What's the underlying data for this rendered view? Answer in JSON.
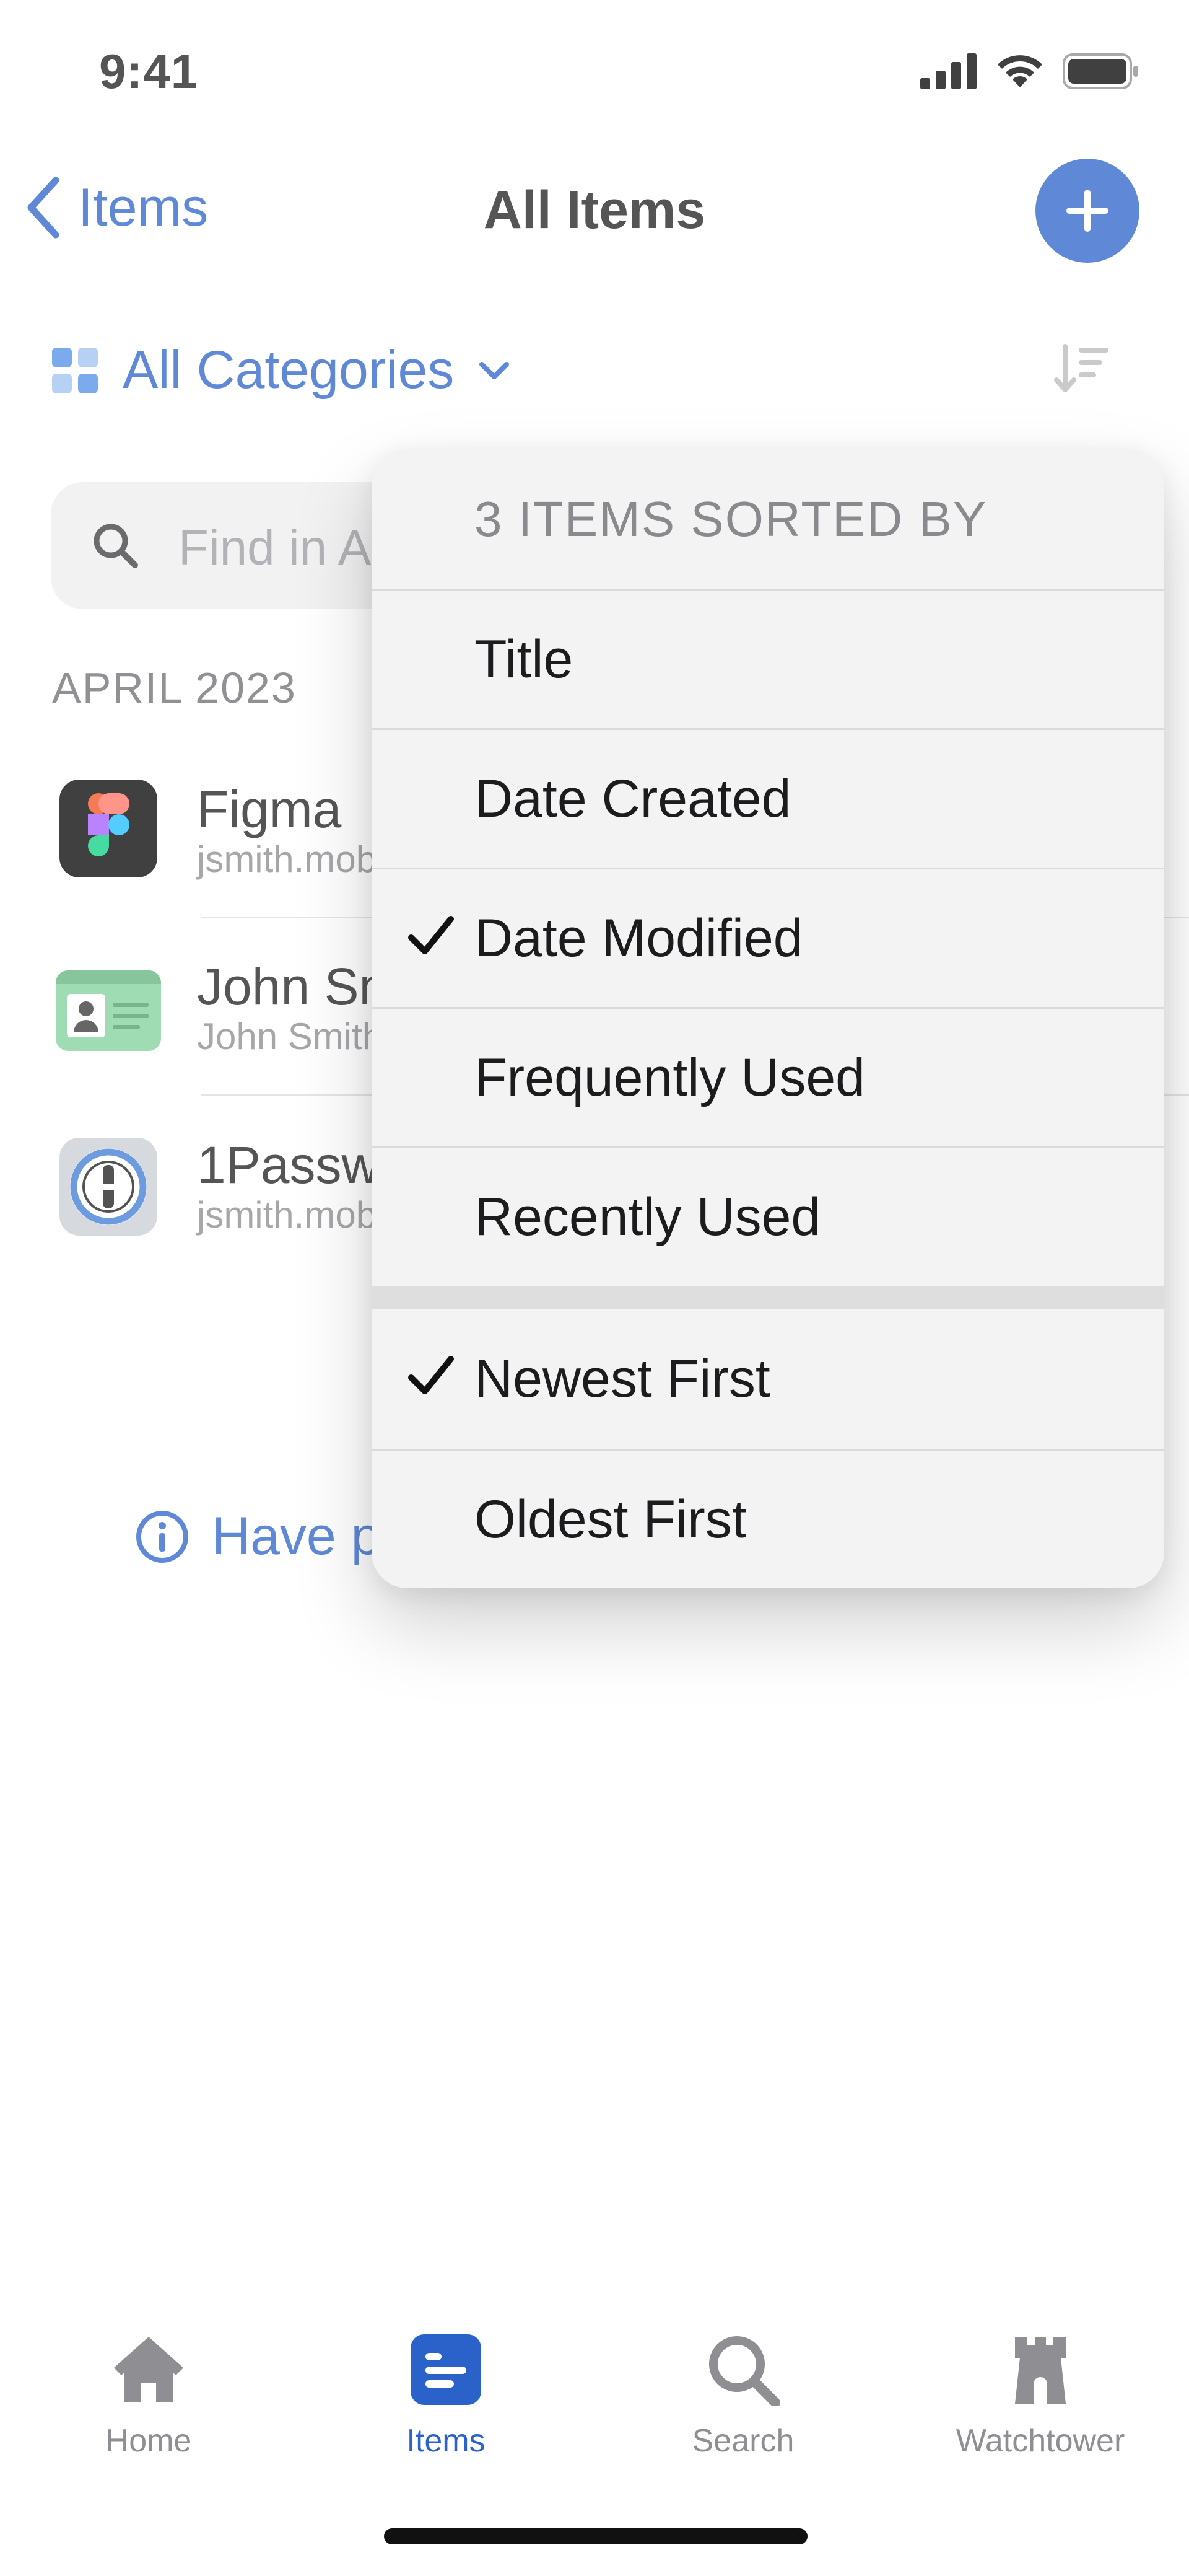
{
  "status_bar": {
    "time": "9:41"
  },
  "nav": {
    "back_label": "Items",
    "title": "All Items"
  },
  "filter": {
    "category_label": "All Categories"
  },
  "search": {
    "placeholder": "Find in All Items"
  },
  "list": {
    "section_header": "APRIL 2023",
    "items": [
      {
        "title": "Figma",
        "subtitle": "jsmith.mobile@example.com",
        "icon": "figma-icon"
      },
      {
        "title": "John Smith",
        "subtitle": "John Smith",
        "icon": "identity-card-icon"
      },
      {
        "title": "1Password Account",
        "subtitle": "jsmith.mobile@example.com",
        "icon": "onepassword-icon"
      }
    ],
    "info_link": "Have products to import?"
  },
  "sort_menu": {
    "header": "3 ITEMS SORTED BY",
    "sort_fields": [
      {
        "label": "Title",
        "checked": false
      },
      {
        "label": "Date Created",
        "checked": false
      },
      {
        "label": "Date Modified",
        "checked": true
      },
      {
        "label": "Frequently Used",
        "checked": false
      },
      {
        "label": "Recently Used",
        "checked": false
      }
    ],
    "sort_orders": [
      {
        "label": "Newest First",
        "checked": true
      },
      {
        "label": "Oldest First",
        "checked": false
      }
    ]
  },
  "tab_bar": {
    "tabs": [
      {
        "label": "Home",
        "icon": "home-icon",
        "active": false
      },
      {
        "label": "Items",
        "icon": "items-icon",
        "active": true
      },
      {
        "label": "Search",
        "icon": "search-icon",
        "active": false
      },
      {
        "label": "Watchtower",
        "icon": "watchtower-icon",
        "active": false
      }
    ]
  },
  "colors": {
    "accent": "#2a62c9",
    "menu_bg": "#f3f3f4",
    "muted": "#8a8a8e"
  }
}
